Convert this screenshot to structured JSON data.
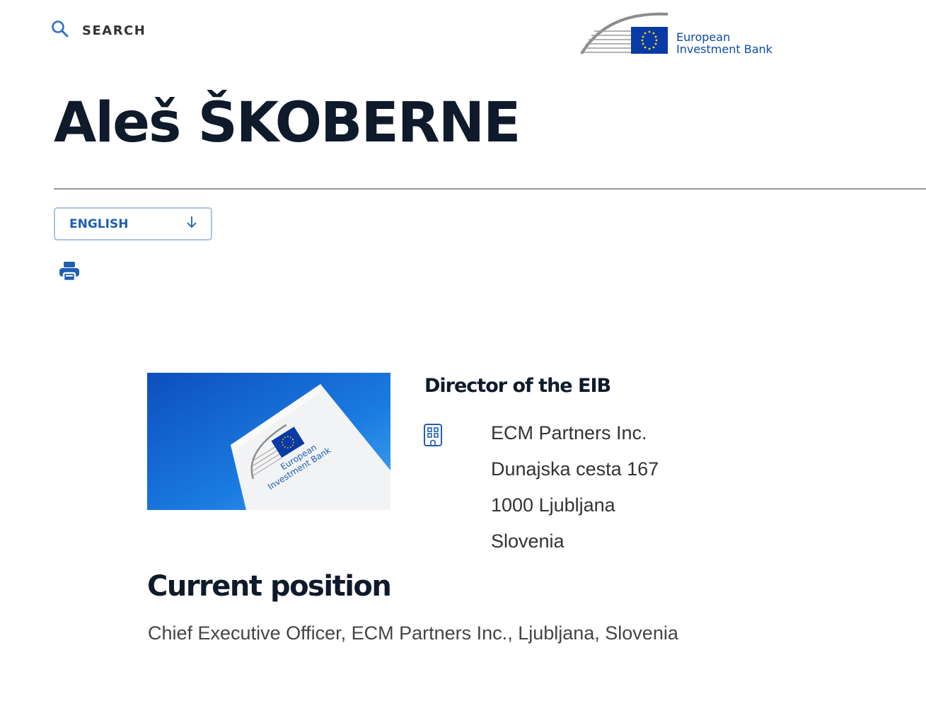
{
  "header": {
    "search_label": "SEARCH",
    "logo_line1": "European",
    "logo_line2": "Investment Bank"
  },
  "profile": {
    "name": "Aleš ŠKOBERNE",
    "language_selected": "ENGLISH",
    "role_title": "Director of the EIB",
    "photo_label_line1": "European",
    "photo_label_line2": "Investment Bank",
    "address": [
      "ECM Partners Inc.",
      "Dunajska cesta 167",
      "1000 Ljubljana",
      "Slovenia"
    ]
  },
  "current_position": {
    "heading": "Current position",
    "text": "Chief Executive Officer, ECM Partners Inc., Ljubljana, Slovenia"
  },
  "colors": {
    "accent": "#1f5fb4",
    "eu_blue": "#0a3aa6",
    "eu_star": "#ffdd00",
    "heading": "#0f1a2b",
    "divider": "#9a9a9a"
  },
  "icons": {
    "search": "search-icon",
    "language_arrow": "arrow-down-icon",
    "print": "printer-icon",
    "address": "building-icon"
  }
}
